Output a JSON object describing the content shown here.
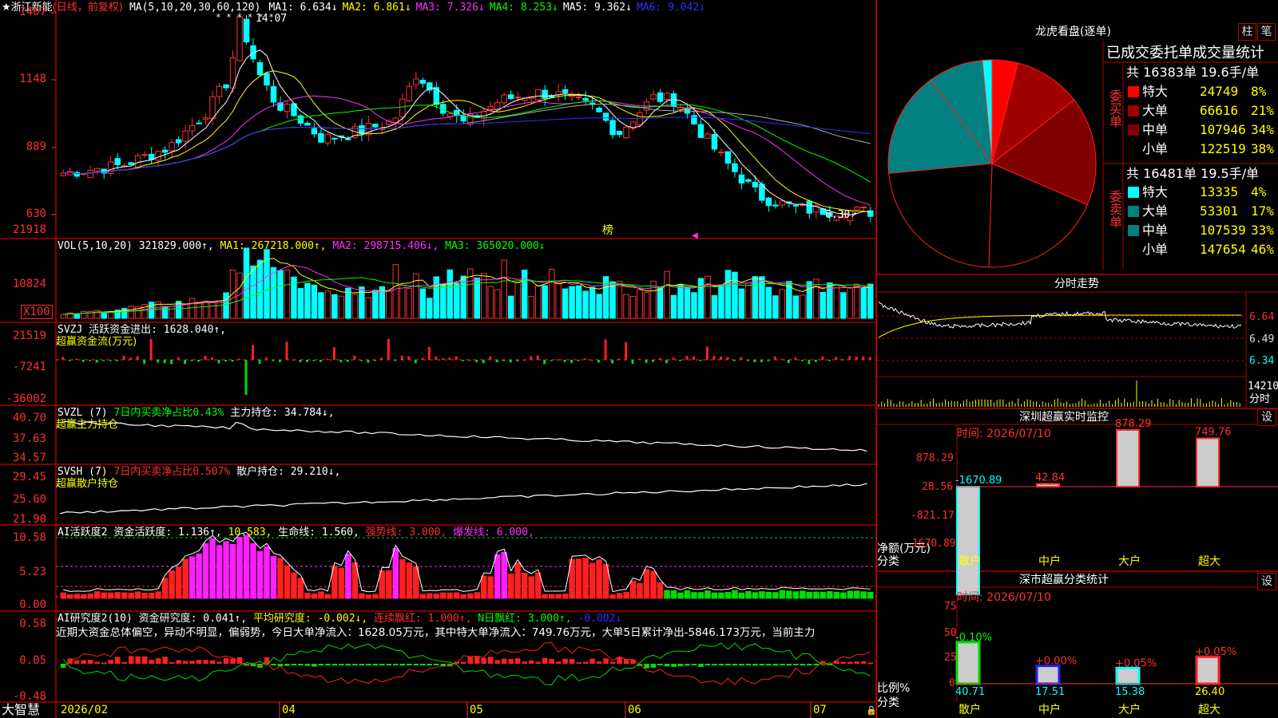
{
  "main": {
    "stock_name": "★浙江新能",
    "period": "(日线，前复权)",
    "ma_header": "MA(5,10,20,30,60,120)",
    "ma": [
      {
        "label": "MA1: 6.634↓",
        "color": "#ffffff"
      },
      {
        "label": "MA2: 6.861↓",
        "color": "#ffff00"
      },
      {
        "label": "MA3: 7.326↓",
        "color": "#ff30ff"
      },
      {
        "label": "MA4: 8.253↓",
        "color": "#00ff00"
      },
      {
        "label": "MA5: 9.362↓",
        "color": "#ffffff"
      },
      {
        "label": "MA6: 9.042↓",
        "color": "#3030ff"
      }
    ],
    "y_ticks": [
      "1407",
      "1148",
      "889",
      "630"
    ],
    "high_label": "14.07",
    "low_label": "6.30",
    "bang_label": "榜",
    "star_marks": "* *   *   *              *                 *"
  },
  "volume": {
    "header": "VOL(5,10,20)",
    "value": "321829.000↑,",
    "ma1": "MA1: 267218.000↑,",
    "ma2": "MA2: 298715.406↓,",
    "ma3": "MA3: 365020.000↓",
    "y_ticks": [
      "21918",
      "10824"
    ],
    "unit": "X100"
  },
  "svzj": {
    "header": "SVZJ  活跃资金进出: 1628.040↑,",
    "sub": "超赢资金流(万元)",
    "y_ticks": [
      "21519",
      "-7241",
      "-36002"
    ]
  },
  "svzl": {
    "header": "SVZL (7)",
    "ratio": "7日内买卖净占比0.43%",
    "hold": "主力持仓: 34.784↓,",
    "sub": "超赢主力持仓",
    "y_ticks": [
      "40.70",
      "37.63",
      "34.57"
    ]
  },
  "svsh": {
    "header": "SVSH (7)",
    "ratio": "7日内买卖净占比0.507%",
    "hold": "散户持仓: 29.210↓,",
    "sub": "超赢散户持仓",
    "y_ticks": [
      "29.45",
      "25.60",
      "21.90"
    ]
  },
  "ai_active": {
    "header": "AI活跃度2",
    "act": "资金活跃度: 1.136↑,",
    "v2": "10.583,",
    "life": "生命线: 1.560,",
    "strong": "强势线: 3.000,",
    "burst": "爆发线: 6.000,",
    "y_ticks": [
      "10.58",
      "5.23",
      "0.00"
    ]
  },
  "ai_research": {
    "header": "AI研究度2(10)",
    "deg": "资金研究度: 0.041↑,",
    "avg": "平均研究度: -0.002↓,",
    "lian": "连续飘红: 1.000↑,",
    "nday": "N日飘红: 3.000↑,",
    "last": "-0.002↓",
    "comment": "近期大资金总体偏空，异动不明显，偏弱势，今日大单净流入：1628.05万元，其中特大单净流入：749.76万元，大单5日累计净出-5846.173万元，当前主力",
    "y_ticks": [
      "0.58",
      "0.05",
      "-0.48"
    ]
  },
  "bottom": {
    "brand": "大智慧",
    "dates": [
      "2026/02",
      "04",
      "05",
      "06",
      "07"
    ]
  },
  "lhb": {
    "title": "龙虎看盘(逐单)",
    "btn1": "柱",
    "btn2": "笔",
    "subtitle": "已成交委托单成交量统计",
    "buy_total": "共 16383单 19.6手/单",
    "sell_total": "共 16481单 19.5手/单",
    "buy_side": "委买单",
    "sell_side": "委卖单",
    "buy": [
      {
        "name": "特大",
        "vol": "24749",
        "pct": "8%",
        "color": "#ff0000"
      },
      {
        "name": "大单",
        "vol": "66616",
        "pct": "21%",
        "color": "#a00000"
      },
      {
        "name": "中单",
        "vol": "107946",
        "pct": "34%",
        "color": "#800000"
      },
      {
        "name": "小单",
        "vol": "122519",
        "pct": "38%",
        "color": "#000000"
      }
    ],
    "sell": [
      {
        "name": "特大",
        "vol": "13335",
        "pct": "4%",
        "color": "#00ffff"
      },
      {
        "name": "大单",
        "vol": "53301",
        "pct": "17%",
        "color": "#008080"
      },
      {
        "name": "中单",
        "vol": "107539",
        "pct": "33%",
        "color": "#008080"
      },
      {
        "name": "小单",
        "vol": "147654",
        "pct": "46%",
        "color": "#000000"
      }
    ]
  },
  "intraday": {
    "title": "分时走势",
    "y_ticks": [
      "6.64",
      "6.49",
      "6.34"
    ],
    "vol_label": "14210",
    "vol_unit": "分时"
  },
  "monitor": {
    "title": "深圳超赢实时监控",
    "settings": "设",
    "time": "时间: 2026/07/10",
    "y_ticks": [
      "878.29",
      "28.56",
      "-821.17",
      "-1670.89"
    ],
    "unit": "净额(万元)",
    "cat_label": "分类",
    "cats": [
      "散户",
      "中户",
      "大户",
      "超大"
    ],
    "values": [
      "-1670.89",
      "42.84",
      "878.29",
      "749.76"
    ]
  },
  "classify": {
    "title": "深市超赢分类统计",
    "settings": "设",
    "time": "时间: 2026/07/10",
    "y_ticks": [
      "75",
      "50",
      "25",
      "0"
    ],
    "unit": "比例%",
    "cat_label": "分类",
    "cats": [
      "散户",
      "中户",
      "大户",
      "超大"
    ],
    "values": [
      "40.71",
      "17.51",
      "15.38",
      "26.40"
    ],
    "changes": [
      "-0.10%",
      "+0.00%",
      "+0.05%",
      "+0.05%"
    ]
  }
}
